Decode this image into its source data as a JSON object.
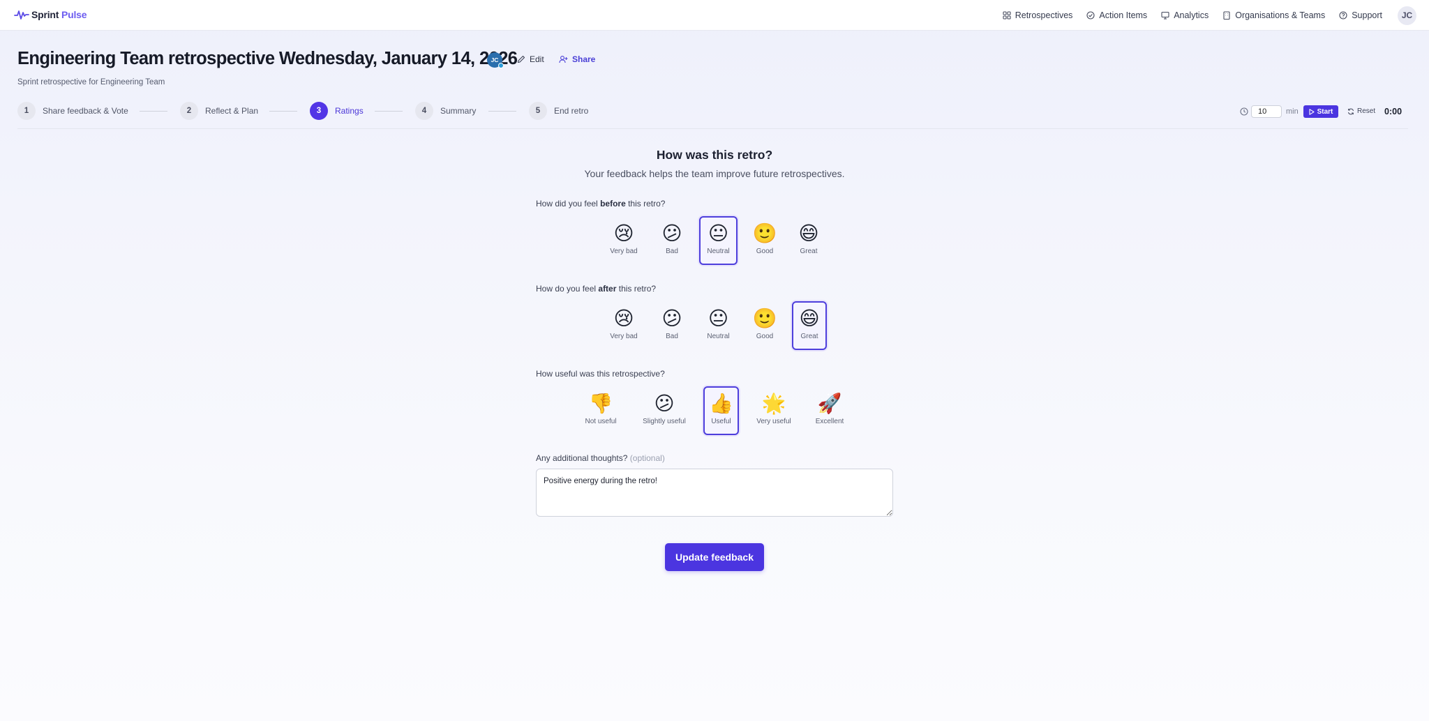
{
  "app": {
    "brand_part1": "Sprint",
    "brand_part2": "Pulse",
    "accent_color": "#4b35e0"
  },
  "nav": {
    "items": [
      {
        "label": "Retrospectives",
        "icon": "grid-icon"
      },
      {
        "label": "Action Items",
        "icon": "check-circle-icon"
      },
      {
        "label": "Analytics",
        "icon": "chart-icon"
      },
      {
        "label": "Organisations & Teams",
        "icon": "building-icon"
      },
      {
        "label": "Support",
        "icon": "help-circle-icon"
      }
    ],
    "avatar": "JC"
  },
  "header": {
    "title": "Engineering Team retrospective Wednesday, January 14, 2026",
    "avatar": "JC",
    "edit_label": "Edit",
    "share_label": "Share",
    "subtitle": "Sprint retrospective for Engineering Team"
  },
  "stepper": {
    "steps": [
      {
        "num": "1",
        "label": "Share feedback & Vote"
      },
      {
        "num": "2",
        "label": "Reflect & Plan"
      },
      {
        "num": "3",
        "label": "Ratings",
        "active": true
      },
      {
        "num": "4",
        "label": "Summary"
      },
      {
        "num": "5",
        "label": "End retro"
      }
    ]
  },
  "timer": {
    "minutes": "10",
    "unit": "min",
    "start_label": "Start",
    "reset_label": "Reset",
    "display": "0:00"
  },
  "survey": {
    "title": "How was this retro?",
    "subtitle": "Your feedback helps the team improve future retrospectives.",
    "q1": {
      "pre": "How did you feel ",
      "bold": "before",
      "post": " this retro?",
      "selected": "Neutral",
      "options": [
        {
          "emoji": "😢",
          "label": "Very bad"
        },
        {
          "emoji": "😕",
          "label": "Bad"
        },
        {
          "emoji": "😐",
          "label": "Neutral"
        },
        {
          "emoji": "🙂",
          "label": "Good"
        },
        {
          "emoji": "😄",
          "label": "Great"
        }
      ]
    },
    "q2": {
      "pre": "How do you feel ",
      "bold": "after",
      "post": " this retro?",
      "selected": "Great",
      "options": [
        {
          "emoji": "😢",
          "label": "Very bad"
        },
        {
          "emoji": "😕",
          "label": "Bad"
        },
        {
          "emoji": "😐",
          "label": "Neutral"
        },
        {
          "emoji": "🙂",
          "label": "Good"
        },
        {
          "emoji": "😄",
          "label": "Great"
        }
      ]
    },
    "q3": {
      "text": "How useful was this retrospective?",
      "selected": "Useful",
      "options": [
        {
          "emoji": "👎",
          "label": "Not useful"
        },
        {
          "emoji": "😕",
          "label": "Slightly useful"
        },
        {
          "emoji": "👍",
          "label": "Useful"
        },
        {
          "emoji": "🌟",
          "label": "Very useful"
        },
        {
          "emoji": "🚀",
          "label": "Excellent"
        }
      ]
    },
    "thoughts": {
      "label": "Any additional thoughts?",
      "optional_tag": "(optional)",
      "value": "Positive energy during the retro!"
    },
    "submit_label": "Update feedback"
  }
}
